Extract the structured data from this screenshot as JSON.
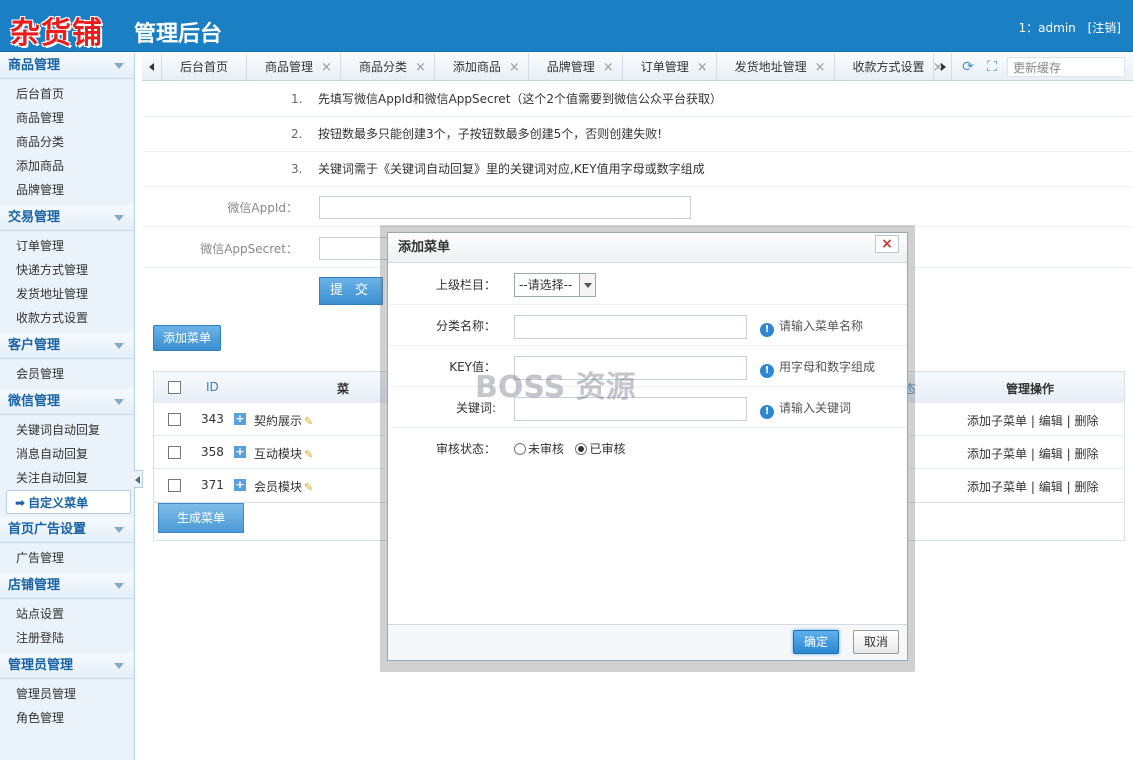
{
  "header": {
    "logo": "杂货铺",
    "title": "管理后台",
    "user": "1：admin",
    "logout": "[注销]"
  },
  "sidebar": {
    "groups": [
      {
        "title": "商品管理",
        "items": [
          "后台首页",
          "商品管理",
          "商品分类",
          "添加商品",
          "品牌管理"
        ]
      },
      {
        "title": "交易管理",
        "items": [
          "订单管理",
          "快递方式管理",
          "发货地址管理",
          "收款方式设置"
        ]
      },
      {
        "title": "客户管理",
        "items": [
          "会员管理"
        ]
      },
      {
        "title": "微信管理",
        "items": [
          "关键词自动回复",
          "消息自动回复",
          "关注自动回复",
          "自定义菜单"
        ]
      },
      {
        "title": "首页广告设置",
        "items": [
          "广告管理"
        ]
      },
      {
        "title": "店铺管理",
        "items": [
          "站点设置",
          "注册登陆"
        ]
      },
      {
        "title": "管理员管理",
        "items": [
          "管理员管理",
          "角色管理"
        ]
      }
    ]
  },
  "tabs": {
    "items": [
      "后台首页",
      "商品管理",
      "商品分类",
      "添加商品",
      "品牌管理",
      "订单管理",
      "发货地址管理",
      "收款方式设置"
    ],
    "close": "×",
    "cache": "更新缓存"
  },
  "tips": [
    {
      "num": "1.",
      "text": "先填写微信AppId和微信AppSecret（这个2个值需要到微信公众平台获取）"
    },
    {
      "num": "2.",
      "text": "按钮数最多只能创建3个，子按钮数最多创建5个，否则创建失败!"
    },
    {
      "num": "3.",
      "text": "关键词需于《关键词自动回复》里的关键词对应,KEY值用字母或数字组成"
    }
  ],
  "form": {
    "appid_label": "微信AppId：",
    "secret_label": "微信AppSecret：",
    "submit": "提 交"
  },
  "add_menu": "添加菜单",
  "table": {
    "head": {
      "id": "ID",
      "name": "菜",
      "status": "态",
      "ops": "管理操作"
    },
    "rows": [
      {
        "id": "343",
        "name": "契約展示",
        "ops": [
          "添加子菜单",
          "编辑",
          "删除"
        ]
      },
      {
        "id": "358",
        "name": "互动模块",
        "ops": [
          "添加子菜单",
          "编辑",
          "删除"
        ]
      },
      {
        "id": "371",
        "name": "会员模块",
        "ops": [
          "添加子菜单",
          "编辑",
          "删除"
        ]
      }
    ],
    "sep": "|"
  },
  "gen_menu": "生成菜单",
  "modal": {
    "title": "添加菜单",
    "parent_label": "上级栏目：",
    "parent_value": "--请选择--",
    "name_label": "分类名称：",
    "name_hint": "请输入菜单名称",
    "key_label": "KEY值：",
    "key_hint": "用字母和数字组成",
    "keyword_label": "关键词:",
    "keyword_hint": "请输入关键词",
    "status_label": "审核状态：",
    "status_off": "未审核",
    "status_on": "已审核",
    "ok": "确定",
    "cancel": "取消"
  },
  "watermark": "BOSS 资源",
  "colors": {
    "header": "#1b7fc4",
    "sidebar": "#eaf2fa",
    "accent": "#3a8fd0",
    "logo": "#e81e1e"
  }
}
